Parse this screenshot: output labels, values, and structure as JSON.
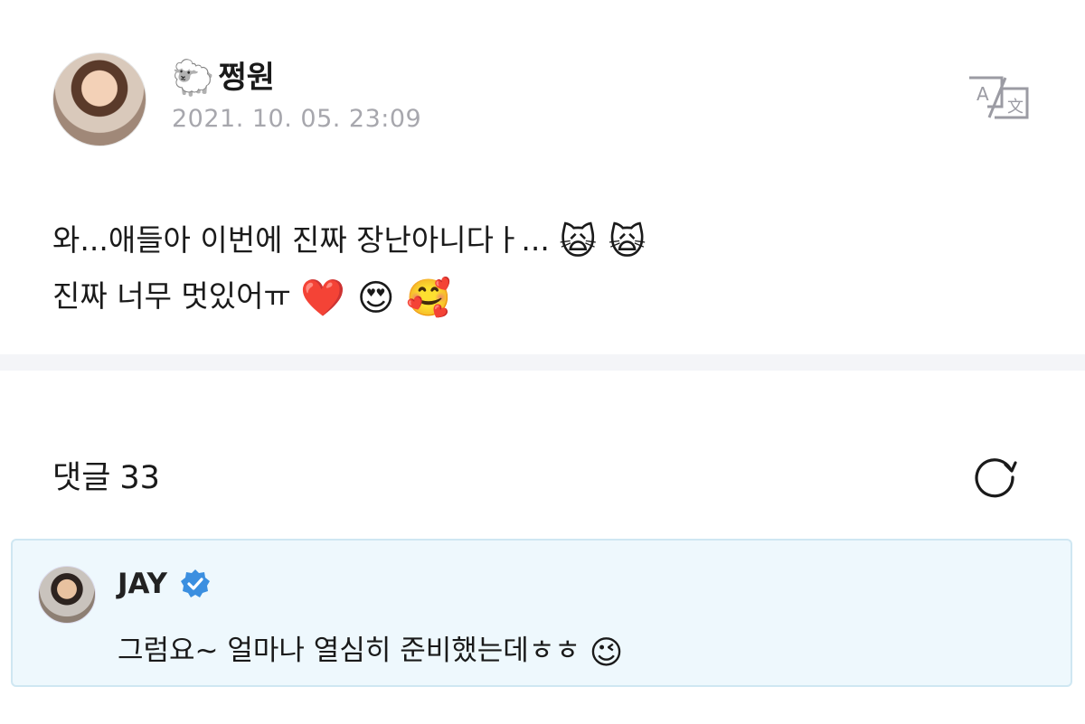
{
  "post": {
    "author_icon": "🐑",
    "author_name": "쩡원",
    "timestamp": "2021. 10. 05. 23:09",
    "line1_text": "와...애들아 이번에 진짜 장난아니다ㅏ...",
    "line1_emoji": "🙀 🙀",
    "line2_text": "진짜 너무 멋있어ㅠ",
    "line2_emoji": "❤️ 😍 🥰"
  },
  "comments": {
    "label": "댓글",
    "count": "33"
  },
  "comment": {
    "name": "JAY",
    "text": "그럼요~ 얼마나 열심히 준비했는데ㅎㅎ",
    "emoji": "😉"
  },
  "icons": {
    "translate": "translate-icon",
    "refresh": "refresh-icon",
    "verified": "verified-badge-icon"
  },
  "colors": {
    "timestamp": "#a7a7ad",
    "comment_bg": "#eef8fd",
    "comment_border": "#cfe7f2",
    "verified": "#3b8fe0"
  }
}
